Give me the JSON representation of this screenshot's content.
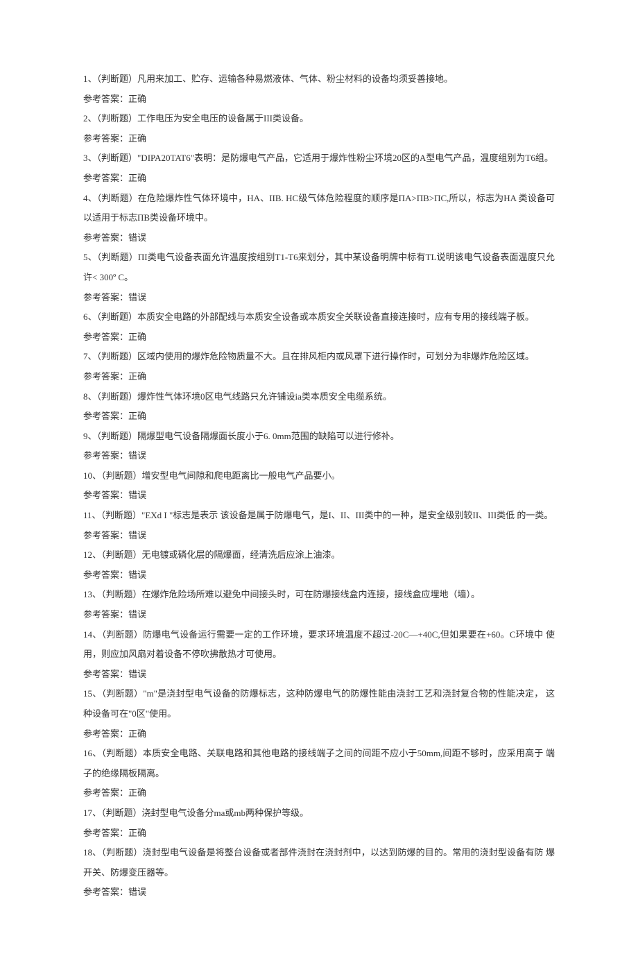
{
  "answer_label_prefix": "参考答案：",
  "items": [
    {
      "q": "1、（判断题）凡用来加工、贮存、运输各种易燃液体、气体、粉尘材料的设备均须妥善接地。",
      "a": "正确"
    },
    {
      "q": "2、（判断题）工作电压为安全电压的设备属于III类设备。",
      "a": "正确"
    },
    {
      "q": "3、（判断题）\"DIPA20TAT6\"表明：是防爆电气产品，它适用于爆炸性粉尘环境20区的A型电气产品，温度组别为T6组。",
      "a": "正确"
    },
    {
      "q": "4、（判断题）在危险爆炸性气体环境中，HA、IIB. HC级气体危险程度的顺序是ПA>ПB>ПC,所以，标志为HA 类设备可以适用于标志ПB类设备环境中。",
      "a": "错误"
    },
    {
      "q": "5、（判断题）ПI类电气设备表面允许温度按组别T1-T6来划分，其中某设备明牌中标有TL说明该电气设备表面温度只允许< 300º C。",
      "a": "错误"
    },
    {
      "q": "6、（判断题）本质安全电路的外部配线与本质安全设备或本质安全关联设备直接连接时，应有专用的接线端子板。",
      "a": "正确"
    },
    {
      "q": "7、（判断题）区域内使用的爆炸危险物质量不大。且在排风柜内或风罩下进行操作时，可划分为非爆炸危险区域。",
      "a": "正确"
    },
    {
      "q": "8、（判断题）爆炸性气体环境0区电气线路只允许铺设ia类本质安全电缆系统。",
      "a": "正确"
    },
    {
      "q": "9、（判断题）隔爆型电气设备隔爆面长度小于6. 0mm范围的缺陷可以进行修补。",
      "a": "错误"
    },
    {
      "q": "10、（判断题）增安型电气间隙和爬电距离比一般电气产品要小。",
      "a": "错误"
    },
    {
      "q": "11、（判断题）\"EXd I \"标志是表示 该设备是属于防爆电气，是I、II、III类中的一种，是安全级别较II、III类低 的一类。",
      "a": "错误"
    },
    {
      "q": "12、（判断题）无电镀或磷化层的隔爆面，经清洗后应涂上油漆。",
      "a": "错误"
    },
    {
      "q": "13、（判断题）在爆炸危险场所难以避免中间接头时，可在防爆接线盒内连接，接线盒应埋地（墙）。",
      "a": "错误"
    },
    {
      "q": "14、（判断题）防爆电气设备运行需要一定的工作环境，要求环境温度不超过-20C—+40C,但如果要在+60。C环境中 使用，则应加风扇对着设备不停吹拂散热才可使用。",
      "a": "错误"
    },
    {
      "q": "15、（判断题）\"m\"是浇封型电气设备的防爆标志，这种防爆电气的防爆性能由浇封工艺和浇封复合物的性能决定， 这种设备可在\"0区\"使用。",
      "a": "正确"
    },
    {
      "q": "16、（判断题）本质安全电路、关联电路和其他电路的接线端子之间的间距不应小于50mm,间距不够时，应采用高于 端子的绝缘隔板隔离。",
      "a": "正确"
    },
    {
      "q": "17、（判断题）浇封型电气设备分ma或mb两种保护等级。",
      "a": "正确"
    },
    {
      "q": "18、（判断题）浇封型电气设备是将整台设备或者部件浇封在浇封剂中，以达到防爆的目的。常用的浇封型设备有防 爆开关、防爆变压器等。",
      "a": "错误"
    }
  ]
}
